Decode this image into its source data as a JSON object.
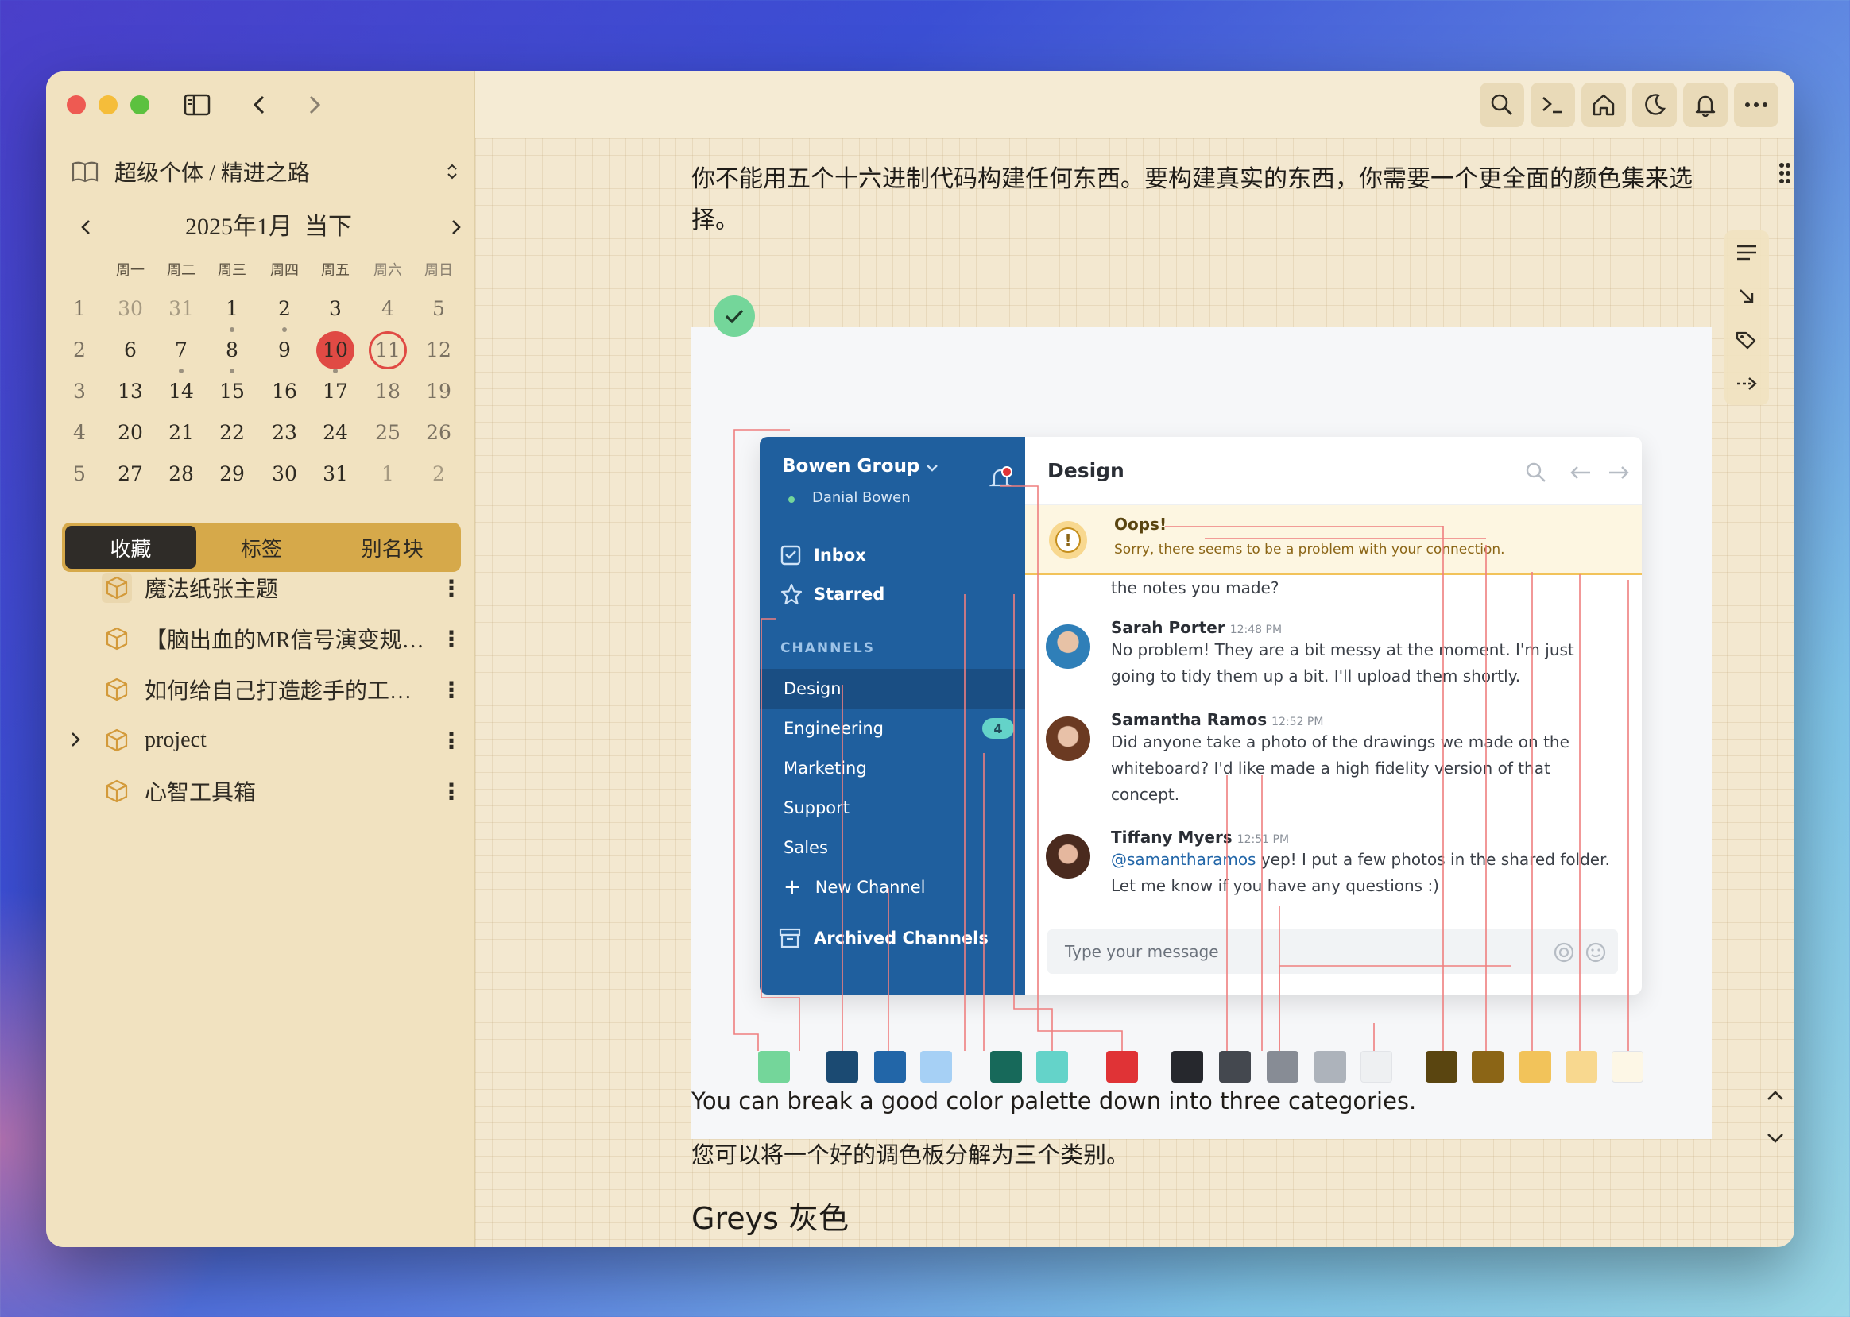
{
  "window": {
    "title": "超级个体 / 精进之路"
  },
  "sidebar": {
    "vault_name": "超级个体 / 精进之路",
    "calendar": {
      "title": "2025年1月",
      "today_label": "当下",
      "weekdays": [
        "周一",
        "周二",
        "周三",
        "周四",
        "周五",
        "周六",
        "周日"
      ],
      "weeks": [
        {
          "week": "1",
          "days": [
            "30",
            "31",
            "1",
            "2",
            "3",
            "4",
            "5"
          ]
        },
        {
          "week": "2",
          "days": [
            "6",
            "7",
            "8",
            "9",
            "10",
            "11",
            "12"
          ]
        },
        {
          "week": "3",
          "days": [
            "13",
            "14",
            "15",
            "16",
            "17",
            "18",
            "19"
          ]
        },
        {
          "week": "4",
          "days": [
            "20",
            "21",
            "22",
            "23",
            "24",
            "25",
            "26"
          ]
        },
        {
          "week": "5",
          "days": [
            "27",
            "28",
            "29",
            "30",
            "31",
            "1",
            "2"
          ]
        }
      ],
      "today": "10",
      "selected": "11"
    },
    "tabs": [
      "收藏",
      "标签",
      "别名块"
    ],
    "favorites": [
      "魔法纸张主题",
      "【脑出血的MR信号演变规律】",
      "如何给自己打造趁手的工具链",
      "project",
      "心智工具箱"
    ]
  },
  "document": {
    "para1": "你不能用五个十六进制代码构建任何东西。要构建真实的东西，你需要一个更全面的颜色集来选择。",
    "para2": "You can break a good color palette down into three categories.",
    "para3": "您可以将一个好的调色板分解为三个类别。",
    "heading": "Greys  灰色"
  },
  "figure": {
    "group_name": "Bowen Group",
    "user_name": "Danial Bowen",
    "inbox": "Inbox",
    "starred": "Starred",
    "channels_header": "CHANNELS",
    "channels": [
      "Design",
      "Engineering",
      "Marketing",
      "Support",
      "Sales"
    ],
    "engineering_badge": "4",
    "new_channel": "New Channel",
    "archived": "Archived Channels",
    "channel_title": "Design",
    "alert_title": "Oops!",
    "alert_body": "Sorry, there seems to be a problem with your connection.",
    "partial_msg": "the notes you made?",
    "messages": [
      {
        "name": "Sarah Porter",
        "time": "12:48 PM",
        "line1": "No problem! They are a bit messy at the moment. I'm just",
        "line2": "going to tidy them up a bit. I'll upload them shortly."
      },
      {
        "name": "Samantha Ramos",
        "time": "12:52 PM",
        "line1": "Did anyone take a photo of the drawings we made on the",
        "line2": "whiteboard? I'd like made a high fidelity version of that",
        "line3": "concept."
      },
      {
        "name": "Tiffany Myers",
        "time": "12:51 PM",
        "mention": "@samantharamos",
        "line1": " yep! I put a few photos in the shared folder.",
        "line2": "Let me know if you have any questions :)"
      }
    ],
    "input_placeholder": "Type your message",
    "palette": [
      "#74d69a",
      "#1b4a72",
      "#2266a8",
      "#a6d0f5",
      "#17695a",
      "#64d3c9",
      "#e03336",
      "#26282d",
      "#44484f",
      "#878c95",
      "#adb3bb",
      "#eef0f2",
      "#5a4510",
      "#8b6516",
      "#f2c35a",
      "#f8d88f",
      "#fdf7e6"
    ]
  }
}
